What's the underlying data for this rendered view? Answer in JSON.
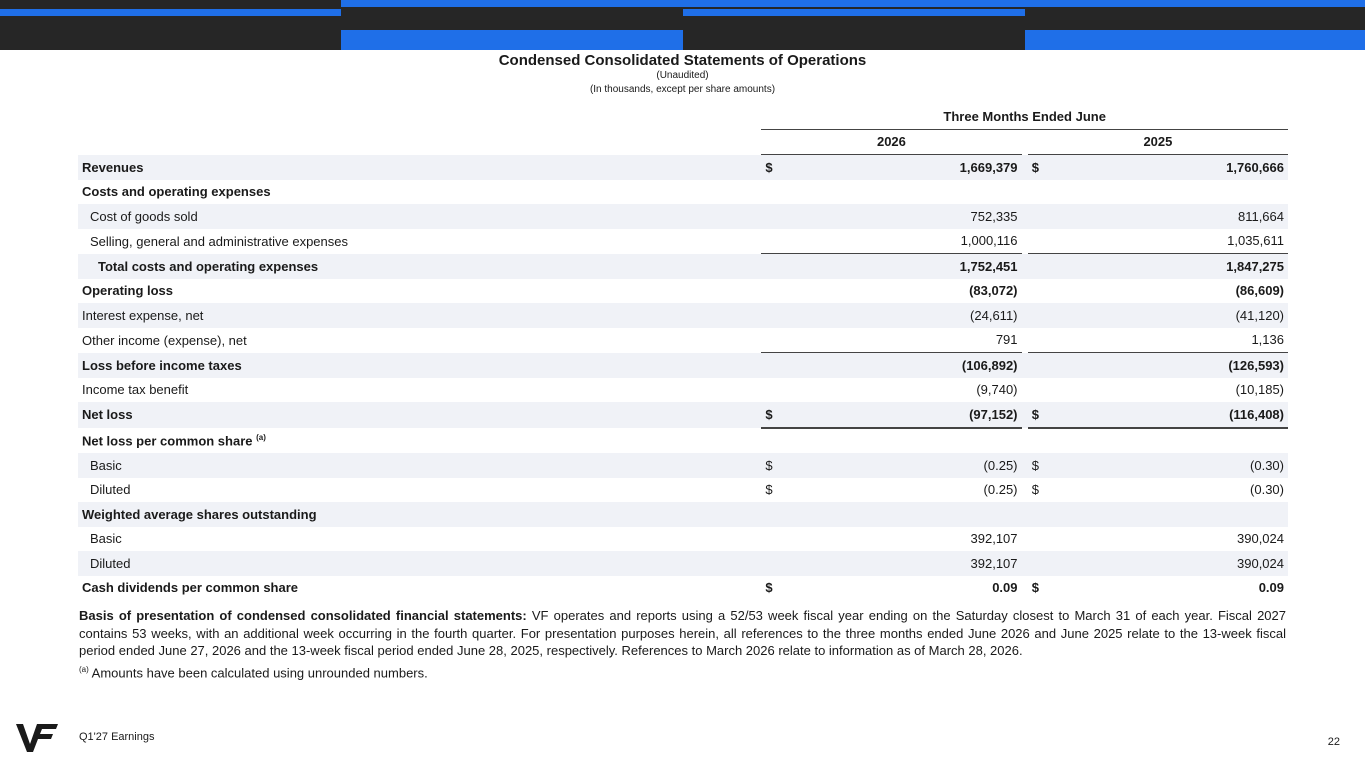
{
  "header": {
    "title": "Condensed Consolidated Statements of Operations",
    "subtitle1": "(Unaudited)",
    "subtitle2": "(In thousands, except per share amounts)"
  },
  "table": {
    "period_header": "Three Months Ended June",
    "col1": "2026",
    "col2": "2025",
    "rows": [
      {
        "label": "Revenues",
        "cur1": "$",
        "v1": "1,669,379",
        "cur2": "$",
        "v2": "1,760,666"
      },
      {
        "label": "Costs and operating expenses"
      },
      {
        "label": "Cost of goods sold",
        "v1": "752,335",
        "v2": "811,664"
      },
      {
        "label": "Selling, general and administrative expenses",
        "v1": "1,000,116",
        "v2": "1,035,611"
      },
      {
        "label": "Total costs and operating expenses",
        "v1": "1,752,451",
        "v2": "1,847,275"
      },
      {
        "label": "Operating loss",
        "v1": "(83,072)",
        "v2": "(86,609)"
      },
      {
        "label": "Interest expense, net",
        "v1": "(24,611)",
        "v2": "(41,120)"
      },
      {
        "label": "Other income (expense), net",
        "v1": "791",
        "v2": "1,136"
      },
      {
        "label": "Loss before income taxes",
        "v1": "(106,892)",
        "v2": "(126,593)"
      },
      {
        "label": "Income tax benefit",
        "v1": "(9,740)",
        "v2": "(10,185)"
      },
      {
        "label": "Net loss",
        "cur1": "$",
        "v1": "(97,152)",
        "cur2": "$",
        "v2": "(116,408)"
      },
      {
        "label": "Net loss per common share",
        "sup": "(a)"
      },
      {
        "label": "Basic",
        "cur1": "$",
        "v1": "(0.25)",
        "cur2": "$",
        "v2": "(0.30)"
      },
      {
        "label": "Diluted",
        "cur1": "$",
        "v1": "(0.25)",
        "cur2": "$",
        "v2": "(0.30)"
      },
      {
        "label": "Weighted average shares outstanding"
      },
      {
        "label": "Basic",
        "v1": "392,107",
        "v2": "390,024"
      },
      {
        "label": "Diluted",
        "v1": "392,107",
        "v2": "390,024"
      },
      {
        "label": "Cash dividends per common share",
        "cur1": "$",
        "v1": "0.09",
        "cur2": "$",
        "v2": "0.09"
      }
    ]
  },
  "notes": {
    "basis_title": "Basis of presentation of condensed consolidated financial statements:",
    "basis_text": " VF operates and reports using a 52/53 week fiscal year ending on the Saturday closest to March 31 of each year. Fiscal 2027 contains 53 weeks, with an additional week occurring in the fourth quarter. For presentation purposes herein, all references to the three months ended June 2026 and June 2025 relate to the 13-week fiscal period ended June 27, 2026 and the 13-week fiscal period ended June 28, 2025, respectively. References to March 2026 relate to information as of March 28, 2026.",
    "footnote_marker": "(a)",
    "footnote_text": " Amounts have been calculated using unrounded numbers."
  },
  "footer": {
    "label": "Q1'27 Earnings",
    "page": "22",
    "logo": "VF"
  },
  "colors": {
    "banner": "#262626",
    "accent": "#1f6fe8",
    "row_shade": "#f0f2f7"
  }
}
